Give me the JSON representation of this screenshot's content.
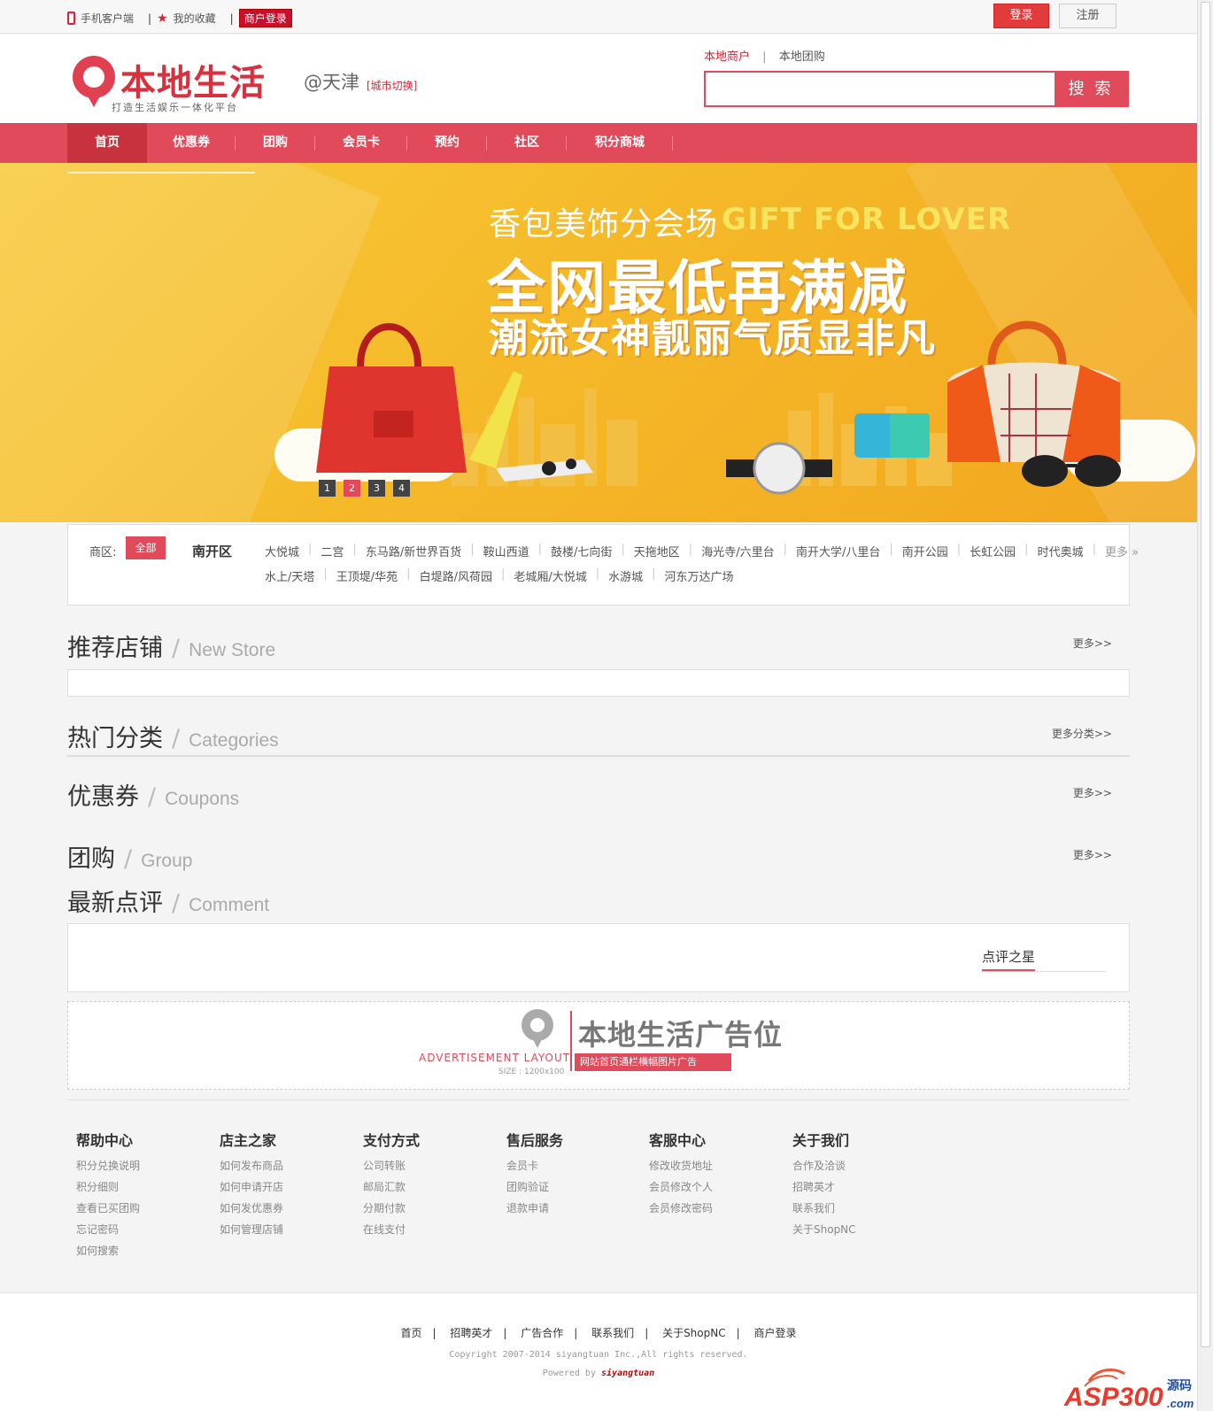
{
  "topbar": {
    "mobile": "手机客户端",
    "favorites": "我的收藏",
    "merchant_login": "商户登录",
    "login": "登录",
    "register": "注册",
    "sep": "|"
  },
  "header": {
    "logo_text": "本地生活",
    "logo_slogan": "打造生活娱乐一体化平台",
    "city": "@天津",
    "city_switch": "[城市切换]",
    "search_tabs": [
      "本地商户",
      "本地团购"
    ],
    "search_tab_sep": "|",
    "search_button": "搜 索",
    "search_value": ""
  },
  "nav": {
    "items": [
      "首页",
      "优惠券",
      "团购",
      "会员卡",
      "预约",
      "社区",
      "积分商城"
    ],
    "active": 0
  },
  "banner": {
    "subtitle": "香包美饰分会场",
    "subtitle_en": "GIFT FOR LOVER",
    "title": "全网最低再满减",
    "title2": "潮流女神靓丽气质显非凡",
    "dots": [
      "1",
      "2",
      "3",
      "4"
    ],
    "active_dot": 1
  },
  "district": {
    "label": "商区:",
    "all": "全部",
    "area": "南开区",
    "row1": [
      "大悦城",
      "二宫",
      "东马路/新世界百货",
      "鞍山西道",
      "鼓楼/七向街",
      "天拖地区",
      "海光寺/六里台",
      "南开大学/八里台",
      "南开公园",
      "长虹公园",
      "时代奥城"
    ],
    "more": "更多 »",
    "row2": [
      "水上/天塔",
      "王顶堤/华苑",
      "白堤路/风荷园",
      "老城厢/大悦城",
      "水游城",
      "河东万达广场"
    ]
  },
  "sections": {
    "store": {
      "cn": "推荐店铺",
      "slash": "/",
      "en": "New Store",
      "more": "更多>>"
    },
    "categories": {
      "cn": "热门分类",
      "slash": "/",
      "en": "Categories",
      "more": "更多分类>>"
    },
    "coupons": {
      "cn": "优惠券",
      "slash": "/",
      "en": "Coupons",
      "more": "更多>>"
    },
    "group": {
      "cn": "团购",
      "slash": "/",
      "en": "Group",
      "more": "更多>>"
    },
    "comment": {
      "cn": "最新点评",
      "slash": "/",
      "en": "Comment",
      "star_label": "点评之星"
    }
  },
  "ad": {
    "title": "本地生活广告位",
    "layout": "ADVERTISEMENT LAYOUT",
    "size": "SIZE : 1200x100",
    "bar": "网站首页通栏横幅图片广告"
  },
  "footer_cols": [
    {
      "title": "帮助中心",
      "links": [
        "积分兑换说明",
        "积分细则",
        "查看已买团购",
        "忘记密码",
        "如何搜索"
      ]
    },
    {
      "title": "店主之家",
      "links": [
        "如何发布商品",
        "如何申请开店",
        "如何发优惠券",
        "如何管理店铺"
      ]
    },
    {
      "title": "支付方式",
      "links": [
        "公司转账",
        "邮局汇款",
        "分期付款",
        "在线支付"
      ]
    },
    {
      "title": "售后服务",
      "links": [
        "会员卡",
        "团购验证",
        "退款申请"
      ]
    },
    {
      "title": "客服中心",
      "links": [
        "修改收货地址",
        "会员修改个人",
        "会员修改密码"
      ]
    },
    {
      "title": "关于我们",
      "links": [
        "合作及洽谈",
        "招聘英才",
        "联系我们",
        "关于ShopNC"
      ]
    }
  ],
  "footer": {
    "links": [
      "首页",
      "招聘英才",
      "广告合作",
      "联系我们",
      "关于ShopNC",
      "商户登录"
    ],
    "sep": "|",
    "copyright": "Copyright 2007-2014 siyangtuan Inc.,All rights reserved.",
    "powered_prefix": "Powered by",
    "powered_brand": "siyangtuan",
    "watermark_main": "ASP300",
    "watermark_cn": "源码",
    "watermark_suffix": ".com"
  },
  "colors": {
    "brand": "#e04a5a",
    "accent_red": "#d8303f",
    "banner": "#f5b928"
  }
}
